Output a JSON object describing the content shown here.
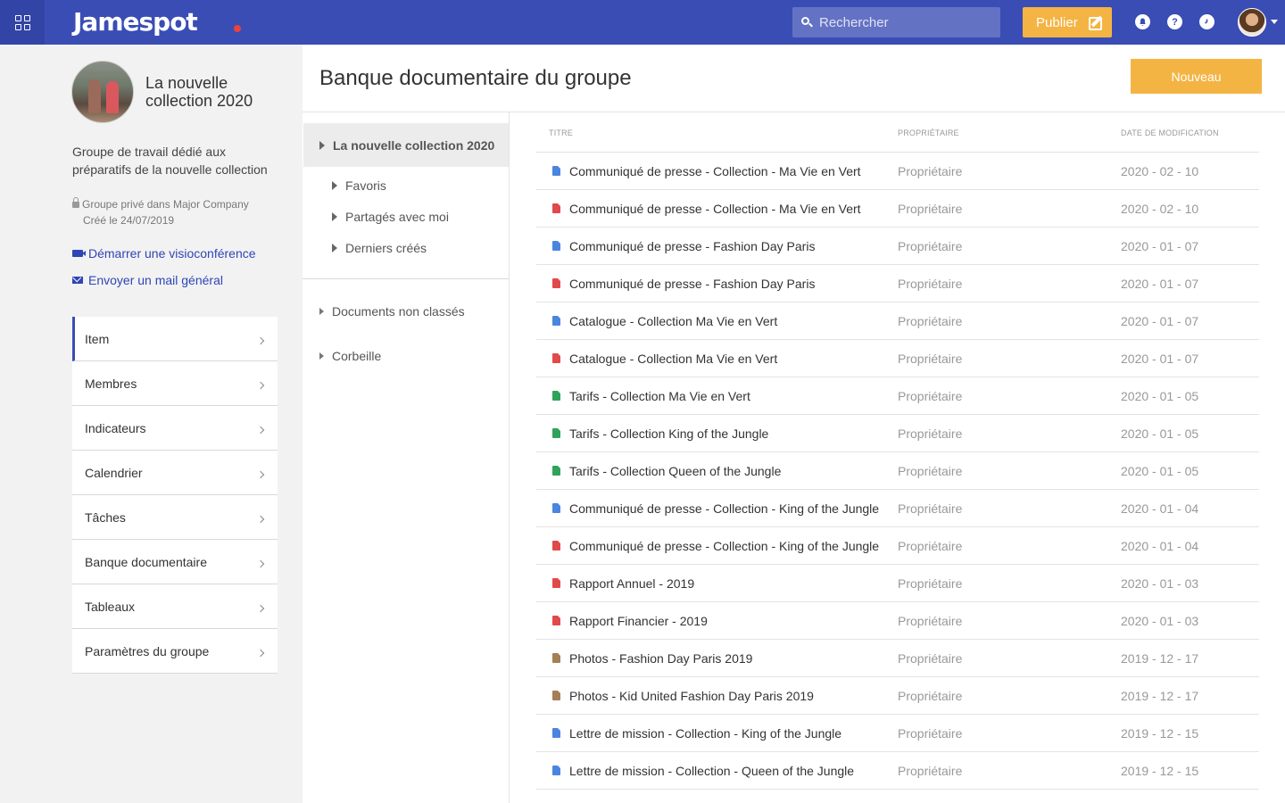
{
  "topbar": {
    "logo": "Jamespot",
    "search_placeholder": "Rechercher",
    "publish_label": "Publier",
    "help_glyph": "?",
    "icons": [
      "apps-grid-icon",
      "search-icon",
      "edit-icon",
      "bell-icon",
      "help-icon",
      "clock-icon",
      "user-avatar",
      "chevron-down-icon"
    ]
  },
  "group": {
    "name": "La nouvelle collection 2020",
    "description": "Groupe de travail dédié aux préparatifs de la nouvelle collection",
    "privacy": "Groupe privé dans Major Company",
    "created": "Créé le 24/07/2019",
    "video_link": "Démarrer une visioconférence",
    "mail_link": "Envoyer un mail général"
  },
  "sidebar": {
    "items": [
      {
        "label": "Item"
      },
      {
        "label": "Membres"
      },
      {
        "label": "Indicateurs"
      },
      {
        "label": "Calendrier"
      },
      {
        "label": "Tâches"
      },
      {
        "label": "Banque documentaire"
      },
      {
        "label": "Tableaux"
      },
      {
        "label": "Paramètres du groupe"
      }
    ]
  },
  "main": {
    "title": "Banque documentaire du groupe",
    "new_button": "Nouveau"
  },
  "folders": {
    "root": "La nouvelle collection 2020",
    "sub": [
      "Favoris",
      "Partagés avec moi",
      "Derniers créés"
    ],
    "unclassified": "Documents non classés",
    "trash": "Corbeille"
  },
  "table": {
    "headers": {
      "title": "TITRE",
      "owner": "PROPRIÉTAIRE",
      "date": "DATE DE MODIFICATION"
    },
    "rows": [
      {
        "title": "Communiqué de presse - Collection - Ma Vie en Vert",
        "owner": "Propriétaire",
        "date": "2020 - 02 - 10",
        "type": "doc"
      },
      {
        "title": "Communiqué de presse - Collection - Ma Vie en Vert",
        "owner": "Propriétaire",
        "date": "2020 - 02 - 10",
        "type": "pdf"
      },
      {
        "title": "Communiqué de presse - Fashion Day Paris",
        "owner": "Propriétaire",
        "date": "2020 - 01 - 07",
        "type": "doc"
      },
      {
        "title": "Communiqué de presse - Fashion Day Paris",
        "owner": "Propriétaire",
        "date": "2020 - 01 - 07",
        "type": "pdf"
      },
      {
        "title": "Catalogue -  Collection Ma Vie en Vert",
        "owner": "Propriétaire",
        "date": "2020 - 01 - 07",
        "type": "doc"
      },
      {
        "title": "Catalogue -  Collection Ma Vie en Vert",
        "owner": "Propriétaire",
        "date": "2020 - 01 - 07",
        "type": "pdf"
      },
      {
        "title": "Tarifs - Collection Ma Vie en Vert",
        "owner": "Propriétaire",
        "date": "2020 - 01 - 05",
        "type": "sheet"
      },
      {
        "title": "Tarifs - Collection King of the Jungle",
        "owner": "Propriétaire",
        "date": "2020 - 01 - 05",
        "type": "sheet"
      },
      {
        "title": "Tarifs - Collection Queen of the Jungle",
        "owner": "Propriétaire",
        "date": "2020 - 01 - 05",
        "type": "sheet"
      },
      {
        "title": "Communiqué de presse - Collection - King of the Jungle",
        "owner": "Propriétaire",
        "date": "2020 - 01 - 04",
        "type": "doc"
      },
      {
        "title": "Communiqué de presse - Collection - King of the Jungle",
        "owner": "Propriétaire",
        "date": "2020 - 01 - 04",
        "type": "pdf"
      },
      {
        "title": "Rapport Annuel - 2019",
        "owner": "Propriétaire",
        "date": "2020 - 01 - 03",
        "type": "pdf"
      },
      {
        "title": "Rapport Financier - 2019",
        "owner": "Propriétaire",
        "date": "2020 - 01 - 03",
        "type": "pdf"
      },
      {
        "title": "Photos - Fashion Day Paris 2019",
        "owner": "Propriétaire",
        "date": "2019 - 12 - 17",
        "type": "archive"
      },
      {
        "title": "Photos - Kid United Fashion Day Paris 2019",
        "owner": "Propriétaire",
        "date": "2019 - 12 - 17",
        "type": "archive"
      },
      {
        "title": "Lettre de mission - Collection - King of the Jungle",
        "owner": "Propriétaire",
        "date": "2019 - 12 - 15",
        "type": "doc"
      },
      {
        "title": "Lettre de mission - Collection - Queen of the Jungle",
        "owner": "Propriétaire",
        "date": "2019 - 12 - 15",
        "type": "doc"
      }
    ]
  },
  "colors": {
    "topbar": "#3a4db5",
    "accent": "#f4b443",
    "link": "#2f45b5",
    "doc": "#4a86e0",
    "pdf": "#e2494a",
    "sheet": "#2fa35a",
    "archive": "#a57f55"
  }
}
